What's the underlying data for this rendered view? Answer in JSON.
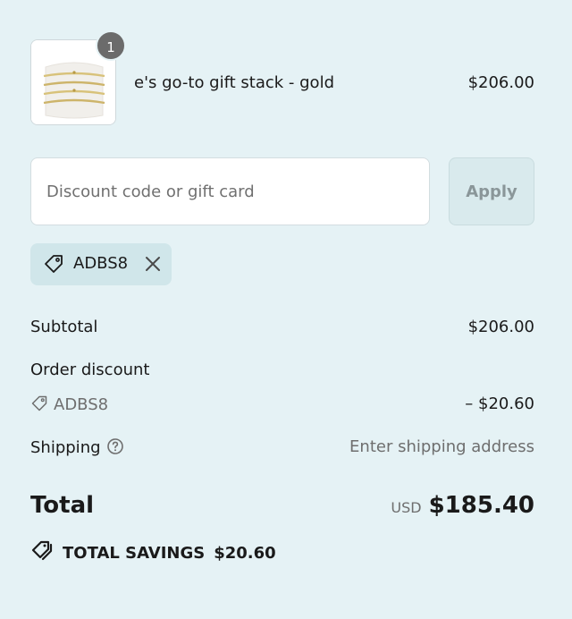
{
  "product": {
    "quantity": "1",
    "name": "e's go-to gift stack - gold",
    "price": "$206.00",
    "image": "bracelet-stack-thumbnail"
  },
  "discount": {
    "placeholder": "Discount code or gift card",
    "value": "",
    "apply_label": "Apply",
    "applied_code": "ADBS8"
  },
  "summary": {
    "subtotal_label": "Subtotal",
    "subtotal_value": "$206.00",
    "order_discount_label": "Order discount",
    "discount_code": "ADBS8",
    "discount_value": "– $20.60",
    "shipping_label": "Shipping",
    "shipping_value": "Enter shipping address",
    "total_label": "Total",
    "currency": "USD",
    "total_value": "$185.40",
    "savings_label": "TOTAL SAVINGS",
    "savings_value": "$20.60"
  },
  "icons": {
    "tag": "tag-icon",
    "remove": "close-icon",
    "help": "question-circle-icon",
    "savings": "tags-icon"
  },
  "colors": {
    "background": "#e5f2f5",
    "badge": "#6b6b6b",
    "chip": "#d0e6ea",
    "apply_disabled": "#d9eaed",
    "muted_text": "#6e6e6e"
  }
}
